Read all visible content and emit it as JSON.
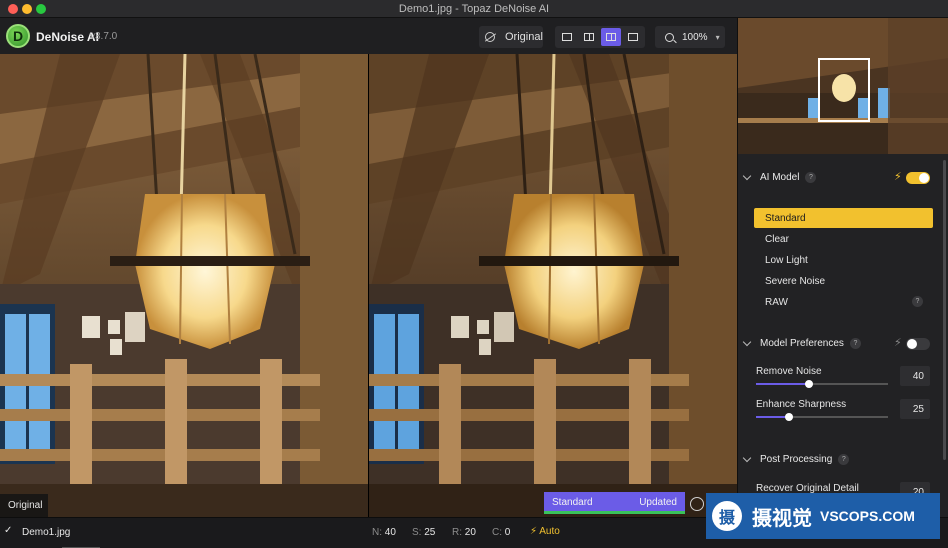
{
  "window": {
    "title": "Demo1.jpg - Topaz DeNoise AI"
  },
  "toolbar": {
    "app_name": "DeNoise AI",
    "version": "v3.7.0",
    "original_button": "Original",
    "zoom": "100%",
    "views": [
      "single-view-icon",
      "split-view-icon",
      "side-by-side-icon",
      "comparison-view-icon"
    ],
    "active_view_index": 2
  },
  "preview": {
    "left_label": "Original",
    "right_model": "Standard",
    "right_status": "Updated"
  },
  "panel": {
    "ai_model": {
      "title": "AI Model",
      "help": "?",
      "auto_enabled": true,
      "models": [
        "Standard",
        "Clear",
        "Low Light",
        "Severe Noise",
        "RAW"
      ],
      "selected_index": 0,
      "raw_help": "?"
    },
    "model_preferences": {
      "title": "Model Preferences",
      "help": "?",
      "enabled": false,
      "sliders": [
        {
          "label": "Remove Noise",
          "value": "40",
          "fraction": 0.4
        },
        {
          "label": "Enhance Sharpness",
          "value": "25",
          "fraction": 0.25
        }
      ]
    },
    "post_processing": {
      "title": "Post Processing",
      "help": "?",
      "recover_label": "Recover Original Detail",
      "recover_value": "20"
    }
  },
  "statusbar": {
    "file": "Demo1.jpg",
    "n_key": "N:",
    "n_val": "40",
    "s_key": "S:",
    "s_val": "25",
    "r_key": "R:",
    "r_val": "20",
    "c_key": "C:",
    "c_val": "0",
    "auto": "Auto"
  },
  "watermark": {
    "logo_char": "摄",
    "cn": "摄视觉",
    "en": "VSCOPS.COM"
  },
  "colors": {
    "accent_yellow": "#f2c12e",
    "accent_purple": "#6b5ce7",
    "badge_green": "#3ac25b",
    "watermark_blue": "#1e5ea8"
  }
}
